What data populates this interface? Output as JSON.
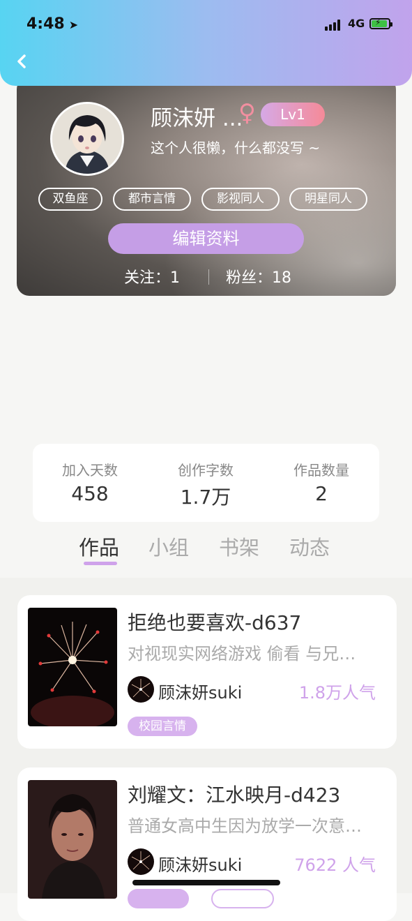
{
  "status": {
    "time": "4:48",
    "network": "4G"
  },
  "profile": {
    "name": "顾沫妍 ...",
    "gender_symbol": "♀",
    "level": "Lv1",
    "bio": "这个人很懒，什么都没写 ~",
    "tags": [
      "双鱼座",
      "都市言情",
      "影视同人",
      "明星同人"
    ],
    "edit_label": "编辑资料",
    "following_label": "关注：",
    "following_count": "1",
    "fans_label": "粉丝：",
    "fans_count": "18"
  },
  "stats": [
    {
      "label": "加入天数",
      "value": "458"
    },
    {
      "label": "创作字数",
      "value": "1.7万"
    },
    {
      "label": "作品数量",
      "value": "2"
    }
  ],
  "tabs": [
    "作品",
    "小组",
    "书架",
    "动态"
  ],
  "works": [
    {
      "title": "拒绝也要喜欢-d637",
      "desc": "对视现实网络游戏 偷看 与兄…",
      "author": "顾沫妍suki",
      "popularity": "1.8万人气",
      "tag": "校园言情"
    },
    {
      "title": "刘耀文：江水映月-d423",
      "desc": "普通女高中生因为放学一次意…",
      "author": "顾沫妍suki",
      "popularity": "7622 人气"
    }
  ],
  "colors": {
    "accent": "#cfa2ea",
    "header_start": "#57d4f2",
    "header_end": "#c1a3ec"
  }
}
